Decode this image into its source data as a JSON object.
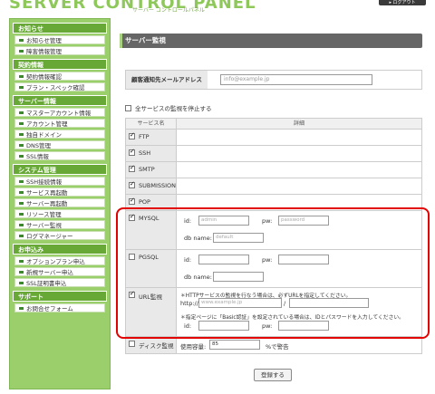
{
  "header": {
    "logo": "SERVER CONTROL PANEL",
    "logo_sub": "サーバー コントロールパネル",
    "logout": "▸ ログアウト"
  },
  "sidebar": {
    "sections": [
      {
        "title": "お知らせ",
        "items": [
          "お知らせ管理",
          "障害情報管理"
        ]
      },
      {
        "title": "契約情報",
        "items": [
          "契約情報確認",
          "プラン・スペック確認"
        ]
      },
      {
        "title": "サーバー情報",
        "items": [
          "マスターアカウント情報",
          "アカウント管理",
          "独自ドメイン",
          "DNS管理",
          "SSL情報"
        ]
      },
      {
        "title": "システム管理",
        "items": [
          "SSH接続情報",
          "サービス再起動",
          "サーバー再起動",
          "リソース管理",
          "サーバー監視",
          "ログマネージャー"
        ]
      },
      {
        "title": "お申込み",
        "items": [
          "オプションプラン申込",
          "新規サーバー申込",
          "SSL証明書申込"
        ]
      },
      {
        "title": "サポート",
        "items": [
          "お問合せフォーム"
        ]
      }
    ]
  },
  "main": {
    "title": "サーバー監視",
    "email_label": "顧客通知先メールアドレス",
    "email_value": "info@example.jp",
    "stop_all_label": "全サービスの監視を停止する",
    "table_head": {
      "service": "サービス名",
      "detail": "詳細"
    },
    "services": {
      "ftp": "FTP",
      "ssh": "SSH",
      "smtp": "SMTP",
      "submission": "SUBMISSION",
      "pop": "POP",
      "mysql": "MYSQL",
      "pgsql": "PGSQL",
      "url": "URL監視",
      "disk": "ディスク監視"
    },
    "fields": {
      "id": "id:",
      "pw": "pw:",
      "db_name": "db name:",
      "http_prefix": "http://",
      "slash": "/",
      "disk_label": "使用容量:",
      "disk_suffix": "%で警告"
    },
    "mysql_values": {
      "id": "admin",
      "pw": "password",
      "db": "default"
    },
    "url_values": {
      "host": "www.example.jp"
    },
    "disk_value": "85",
    "url_note1": "＊HTTPサービスの監視を行なう場合は、必ずURLを指定してください。",
    "url_note2": "＊指定ページに「Basic認証」を設定されている場合は、IDとパスワードを入力してください。",
    "submit_label": "登録する"
  },
  "colors": {
    "sidebar_bg": "#9bcf6b",
    "section_head": "#67a836",
    "title_bar": "#666666",
    "highlight": "#e30000"
  }
}
